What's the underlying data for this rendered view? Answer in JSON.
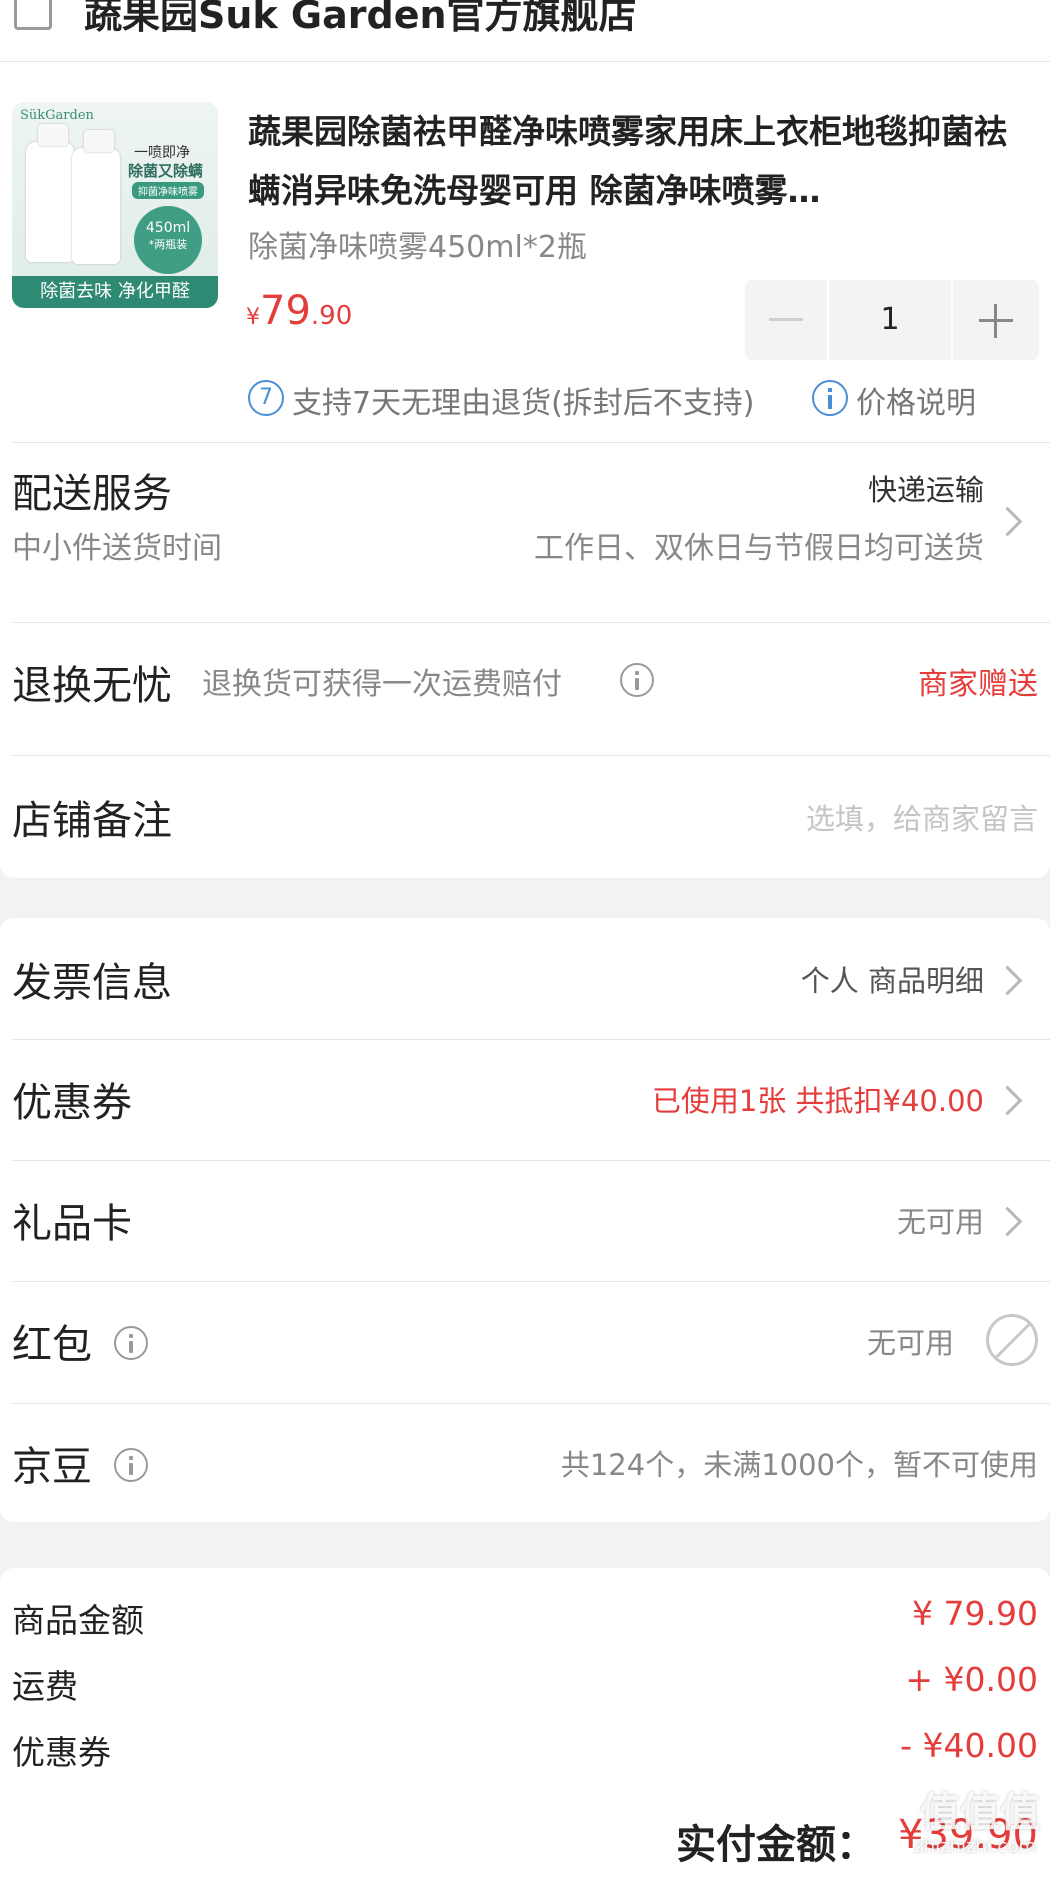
{
  "store": {
    "name": "蔬果园Suk Garden官方旗舰店"
  },
  "product": {
    "image": {
      "brand_mark": "SükGarden",
      "slogan_1": "一喷即净",
      "slogan_2": "除菌又除螨",
      "slogan_3": "抑菌净味喷雾",
      "badge_volume": "450ml",
      "badge_pack": "*两瓶装",
      "banner": "除菌去味 净化甲醛"
    },
    "title": "蔬果园除菌祛甲醛净味喷雾家用床上衣柜地毯抑菌祛螨消异味免洗母婴可用 除菌净味喷雾…",
    "spec": "除菌净味喷雾450ml*2瓶",
    "price_symbol": "¥",
    "price_int": "79",
    "price_dec": ".90",
    "quantity": "1",
    "return_badge": "7",
    "return_text": "支持7天无理由退货(拆封后不支持)",
    "price_note": "价格说明"
  },
  "delivery": {
    "label": "配送服务",
    "method": "快递运输",
    "sub_label": "中小件送货时间",
    "sub_value": "工作日、双休日与节假日均可送货"
  },
  "return_worry": {
    "label": "退换无忧",
    "desc": "退换货可获得一次运费赔付",
    "value": "商家赠送"
  },
  "remark": {
    "label": "店铺备注",
    "placeholder": "选填，给商家留言"
  },
  "invoice": {
    "label": "发票信息",
    "value": "个人 商品明细"
  },
  "coupon": {
    "label": "优惠券",
    "value": "已使用1张 共抵扣¥40.00"
  },
  "gift_card": {
    "label": "礼品卡",
    "value": "无可用"
  },
  "red_packet": {
    "label": "红包",
    "value": "无可用"
  },
  "jd_beans": {
    "label": "京豆",
    "value": "共124个，未满1000个，暂不可使用"
  },
  "summary": {
    "goods_label": "商品金额",
    "goods_value": "¥ 79.90",
    "shipping_label": "运费",
    "shipping_value": "+ ¥0.00",
    "coupon_label": "优惠券",
    "coupon_value": "- ¥40.00",
    "total_label": "实付金额：",
    "total_value": "¥39.90"
  },
  "watermark": {
    "text": "值值值",
    "site": "zhizhizhi.com"
  },
  "colors": {
    "accent_red": "#e43d3b",
    "page_bg": "#f2f2f2",
    "info_blue": "#4a8fd6"
  }
}
